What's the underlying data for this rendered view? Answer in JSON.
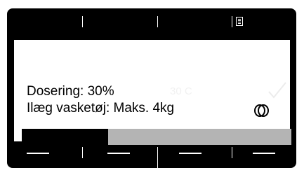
{
  "display": {
    "dosing_text": "Dosering: 30%",
    "load_text": "Ilæg vasketøj: Maks. 4kg",
    "ghost_text": "30 C",
    "progress_fraction": 0.32
  },
  "icons": {
    "top_right": "menu-list-icon",
    "confirm": "check-icon",
    "drum": "drum-icon"
  },
  "colors": {
    "frame": "#000000",
    "screen": "#ffffff",
    "progress_track": "#b4b4b4",
    "progress_fill": "#000000"
  }
}
